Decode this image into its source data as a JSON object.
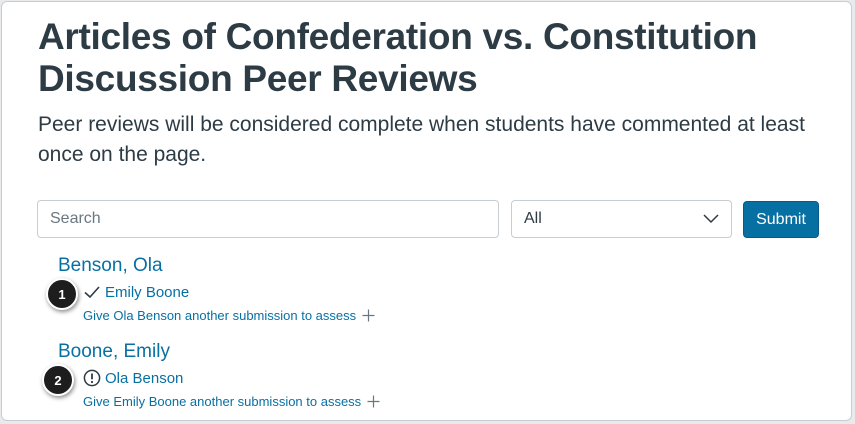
{
  "page": {
    "title": "Articles of Confederation vs. Constitution Discussion Peer Reviews",
    "description": "Peer reviews will be considered complete when students have commented at least once on the page."
  },
  "filters": {
    "search_placeholder": "Search",
    "select_value": "All",
    "submit_label": "Submit"
  },
  "students": [
    {
      "name": "Benson, Ola",
      "reviewer": "Emily Boone",
      "status": "complete",
      "status_icon": "check-icon",
      "assign_text": "Give Ola Benson another submission to assess",
      "callout": "1"
    },
    {
      "name": "Boone, Emily",
      "reviewer": "Ola Benson",
      "status": "incomplete",
      "status_icon": "warning-circle-icon",
      "assign_text": "Give Emily Boone another submission to assess",
      "callout": "2"
    }
  ],
  "colors": {
    "link": "#0770a3",
    "text": "#2d3b45",
    "button": "#0770a3",
    "border": "#c7cdd1"
  }
}
